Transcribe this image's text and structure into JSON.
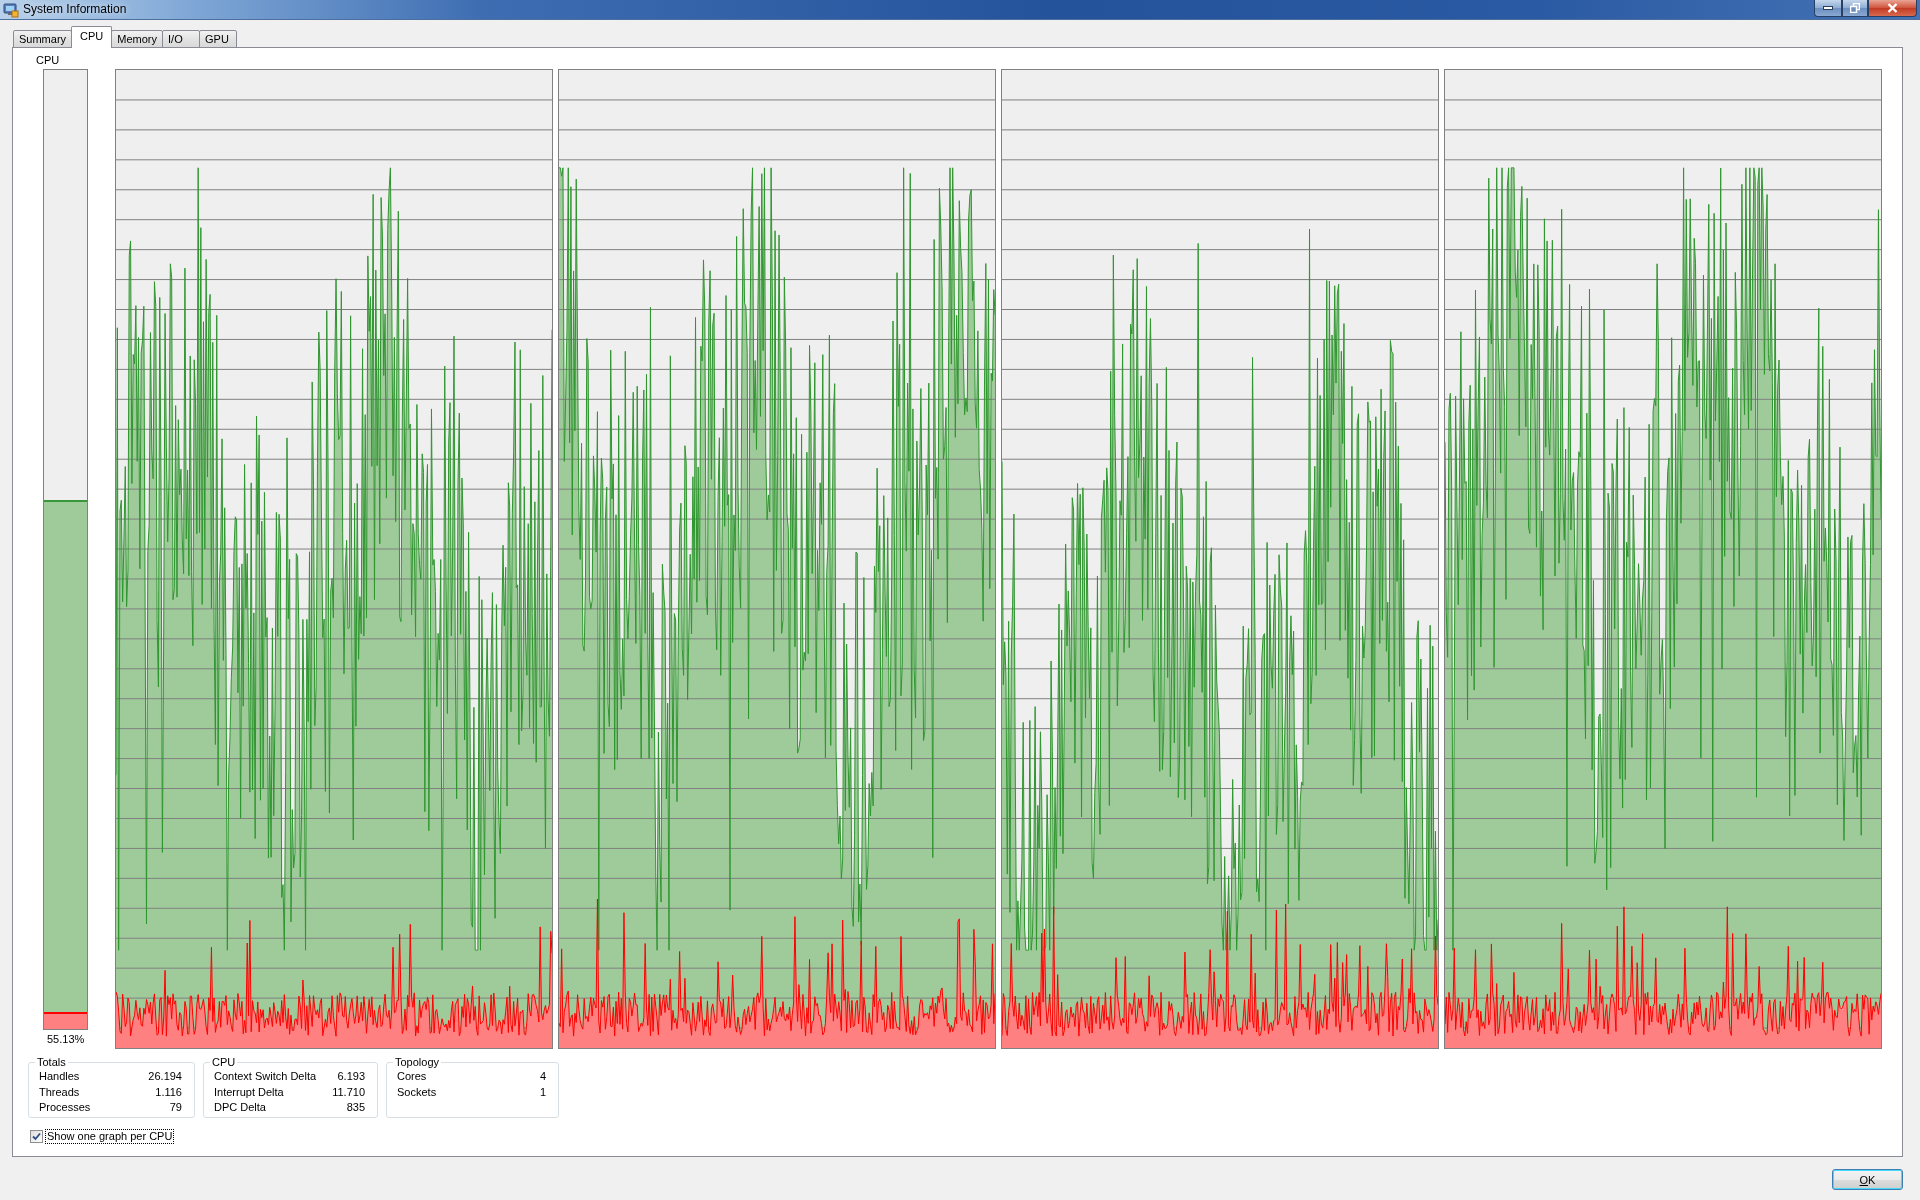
{
  "window": {
    "title": "System Information"
  },
  "tabs": [
    {
      "label": "Summary",
      "selected": false
    },
    {
      "label": "CPU",
      "selected": true
    },
    {
      "label": "Memory",
      "selected": false
    },
    {
      "label": "I/O",
      "selected": false
    },
    {
      "label": "GPU",
      "selected": false
    }
  ],
  "cpu_meter": {
    "label": "CPU",
    "level": 0.5513,
    "kernel": {
      "level": 0.018
    },
    "reading": "55.13%"
  },
  "groups": [
    {
      "title": "Totals",
      "rows": [
        {
          "label": "Handles",
          "value": "26.194"
        },
        {
          "label": "Threads",
          "value": "1.116"
        },
        {
          "label": "Processes",
          "value": "79"
        }
      ]
    },
    {
      "title": "CPU",
      "rows": [
        {
          "label": "Context Switch Delta",
          "value": "6.193"
        },
        {
          "label": "Interrupt Delta",
          "value": "11.710"
        },
        {
          "label": "DPC Delta",
          "value": "835"
        }
      ]
    },
    {
      "title": "Topology",
      "rows": [
        {
          "label": "Cores",
          "value": "4"
        },
        {
          "label": "Sockets",
          "value": "1"
        }
      ]
    }
  ],
  "show_one_graph_per_cpu": {
    "label": "Show one graph per CPU",
    "checked": true
  },
  "buttons": [
    {
      "label": "OK",
      "default": true
    }
  ]
}
